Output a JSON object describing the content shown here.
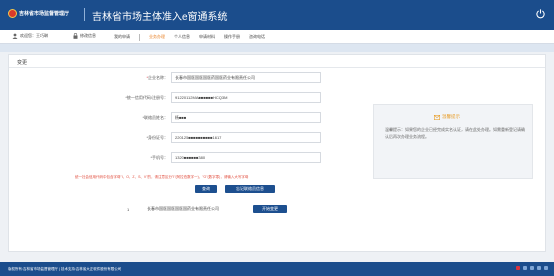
{
  "header": {
    "org_name": "吉林省市场监督管理厅",
    "system_title": "吉林省市场主体准入e窗通系统"
  },
  "nav": {
    "welcome": "欢迎您：王巧琳",
    "change_password": "修改信息",
    "items": [
      {
        "label": "我的申请",
        "active": false
      },
      {
        "label": "业务办理",
        "active": true
      },
      {
        "label": "个人信息",
        "active": false
      },
      {
        "label": "申请材料",
        "active": false
      },
      {
        "label": "操作手册",
        "active": false
      },
      {
        "label": "咨询电话",
        "active": false
      }
    ]
  },
  "card": {
    "title": "变更"
  },
  "form": {
    "company_name": {
      "label": "企业名称：",
      "value": "长春市国医国医国医药国医药业有限责任公司"
    },
    "credit_code": {
      "label": "*统一信用代码/注册号：",
      "value": "91220112MA■■■■■■HCQ3M"
    },
    "contact_name": {
      "label": "*联络员姓名：",
      "value": "杨■■■"
    },
    "id_number": {
      "label": "*身份证号：",
      "value": "220125■■■■■■■■■■1617"
    },
    "phone": {
      "label": "*手机号：",
      "value": "1320■■■■■■380"
    }
  },
  "note": "统一社会信用代码中包含字母\"I、O、Z、S、V\"的，请注意区分\"I\"(阿拉伯数字一)，\"O\"(数字零)，请输入大写字母",
  "buttons": {
    "query": "查询",
    "forgot": "忘记联络员信息",
    "start_change": "开始变更"
  },
  "result": {
    "index": "1",
    "name": "长春市国医国医国医国药业有限责任公司"
  },
  "tip": {
    "title": "温馨提示",
    "body": "温馨提示：如果您的企业已经完成实名认证，请在此处办理。如需重新登记请确认后再次办理业务流程。"
  },
  "footer": {
    "text": "版权所有:吉林省市场监督管理厅 | 技术支持:吉林省大正软件股份有限公司"
  },
  "colors": {
    "primary": "#1b4d8c",
    "accent": "#e8832a",
    "warning": "#e04a3a"
  }
}
